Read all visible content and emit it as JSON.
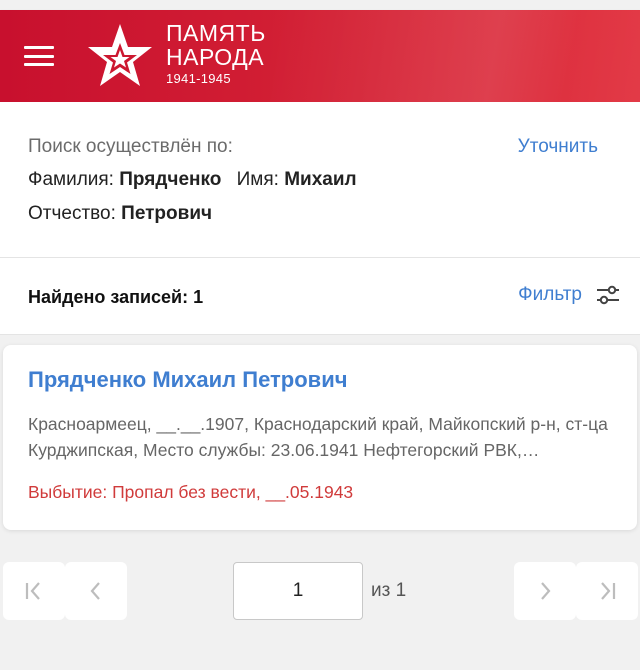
{
  "header": {
    "logo_line1": "ПАМЯТЬ",
    "logo_line2": "НАРОДА",
    "logo_years": "1941-1945",
    "brand_color": "#c8102e"
  },
  "search": {
    "title": "Поиск осуществлён по:",
    "refine_label": "Уточнить",
    "surname_label": "Фамилия:",
    "surname_value": "Прядченко",
    "name_label": "Имя:",
    "name_value": "Михаил",
    "patronymic_label": "Отчество:",
    "patronymic_value": "Петрович"
  },
  "results": {
    "found_label": "Найдено записей: 1",
    "filter_label": "Фильтр"
  },
  "records": [
    {
      "name": "Прядченко Михаил Петрович",
      "description": "Красноармеец, __.__.1907, Краснодарский край, Майкопский р-н, ст-ца Курджипская, Место службы: 23.06.1941 Нефтегорский РВК, Краснодарский край",
      "status": "Выбытие: Пропал без вести, __.05.1943"
    }
  ],
  "pagination": {
    "current_page": "1",
    "of_label": "из 1"
  },
  "icons": {
    "menu": "menu-icon",
    "logo": "red-star-icon",
    "filter": "sliders-icon",
    "first": "first-page-icon",
    "prev": "chevron-left-icon",
    "next": "chevron-right-icon",
    "last": "last-page-icon"
  },
  "colors": {
    "link": "#3f7ed0",
    "status_red": "#d03b3b"
  }
}
